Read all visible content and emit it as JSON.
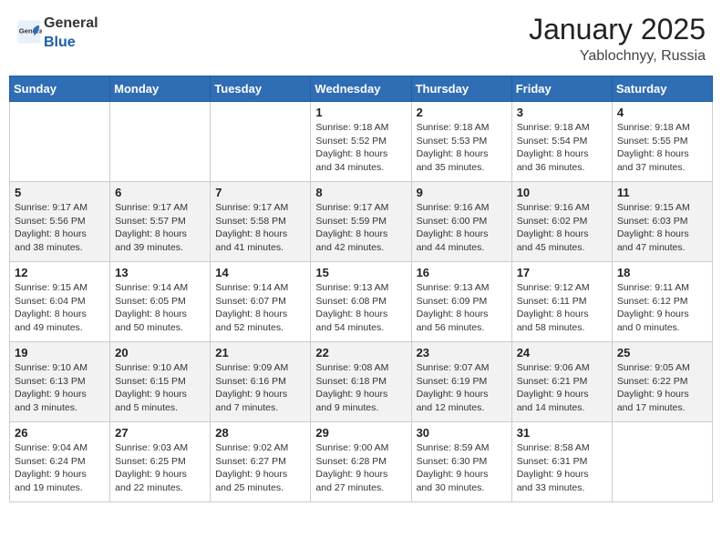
{
  "header": {
    "logo_general": "General",
    "logo_blue": "Blue",
    "month": "January 2025",
    "location": "Yablochnyy, Russia"
  },
  "days_of_week": [
    "Sunday",
    "Monday",
    "Tuesday",
    "Wednesday",
    "Thursday",
    "Friday",
    "Saturday"
  ],
  "weeks": [
    [
      {
        "day": "",
        "info": ""
      },
      {
        "day": "",
        "info": ""
      },
      {
        "day": "",
        "info": ""
      },
      {
        "day": "1",
        "info": "Sunrise: 9:18 AM\nSunset: 5:52 PM\nDaylight: 8 hours\nand 34 minutes."
      },
      {
        "day": "2",
        "info": "Sunrise: 9:18 AM\nSunset: 5:53 PM\nDaylight: 8 hours\nand 35 minutes."
      },
      {
        "day": "3",
        "info": "Sunrise: 9:18 AM\nSunset: 5:54 PM\nDaylight: 8 hours\nand 36 minutes."
      },
      {
        "day": "4",
        "info": "Sunrise: 9:18 AM\nSunset: 5:55 PM\nDaylight: 8 hours\nand 37 minutes."
      }
    ],
    [
      {
        "day": "5",
        "info": "Sunrise: 9:17 AM\nSunset: 5:56 PM\nDaylight: 8 hours\nand 38 minutes."
      },
      {
        "day": "6",
        "info": "Sunrise: 9:17 AM\nSunset: 5:57 PM\nDaylight: 8 hours\nand 39 minutes."
      },
      {
        "day": "7",
        "info": "Sunrise: 9:17 AM\nSunset: 5:58 PM\nDaylight: 8 hours\nand 41 minutes."
      },
      {
        "day": "8",
        "info": "Sunrise: 9:17 AM\nSunset: 5:59 PM\nDaylight: 8 hours\nand 42 minutes."
      },
      {
        "day": "9",
        "info": "Sunrise: 9:16 AM\nSunset: 6:00 PM\nDaylight: 8 hours\nand 44 minutes."
      },
      {
        "day": "10",
        "info": "Sunrise: 9:16 AM\nSunset: 6:02 PM\nDaylight: 8 hours\nand 45 minutes."
      },
      {
        "day": "11",
        "info": "Sunrise: 9:15 AM\nSunset: 6:03 PM\nDaylight: 8 hours\nand 47 minutes."
      }
    ],
    [
      {
        "day": "12",
        "info": "Sunrise: 9:15 AM\nSunset: 6:04 PM\nDaylight: 8 hours\nand 49 minutes."
      },
      {
        "day": "13",
        "info": "Sunrise: 9:14 AM\nSunset: 6:05 PM\nDaylight: 8 hours\nand 50 minutes."
      },
      {
        "day": "14",
        "info": "Sunrise: 9:14 AM\nSunset: 6:07 PM\nDaylight: 8 hours\nand 52 minutes."
      },
      {
        "day": "15",
        "info": "Sunrise: 9:13 AM\nSunset: 6:08 PM\nDaylight: 8 hours\nand 54 minutes."
      },
      {
        "day": "16",
        "info": "Sunrise: 9:13 AM\nSunset: 6:09 PM\nDaylight: 8 hours\nand 56 minutes."
      },
      {
        "day": "17",
        "info": "Sunrise: 9:12 AM\nSunset: 6:11 PM\nDaylight: 8 hours\nand 58 minutes."
      },
      {
        "day": "18",
        "info": "Sunrise: 9:11 AM\nSunset: 6:12 PM\nDaylight: 9 hours\nand 0 minutes."
      }
    ],
    [
      {
        "day": "19",
        "info": "Sunrise: 9:10 AM\nSunset: 6:13 PM\nDaylight: 9 hours\nand 3 minutes."
      },
      {
        "day": "20",
        "info": "Sunrise: 9:10 AM\nSunset: 6:15 PM\nDaylight: 9 hours\nand 5 minutes."
      },
      {
        "day": "21",
        "info": "Sunrise: 9:09 AM\nSunset: 6:16 PM\nDaylight: 9 hours\nand 7 minutes."
      },
      {
        "day": "22",
        "info": "Sunrise: 9:08 AM\nSunset: 6:18 PM\nDaylight: 9 hours\nand 9 minutes."
      },
      {
        "day": "23",
        "info": "Sunrise: 9:07 AM\nSunset: 6:19 PM\nDaylight: 9 hours\nand 12 minutes."
      },
      {
        "day": "24",
        "info": "Sunrise: 9:06 AM\nSunset: 6:21 PM\nDaylight: 9 hours\nand 14 minutes."
      },
      {
        "day": "25",
        "info": "Sunrise: 9:05 AM\nSunset: 6:22 PM\nDaylight: 9 hours\nand 17 minutes."
      }
    ],
    [
      {
        "day": "26",
        "info": "Sunrise: 9:04 AM\nSunset: 6:24 PM\nDaylight: 9 hours\nand 19 minutes."
      },
      {
        "day": "27",
        "info": "Sunrise: 9:03 AM\nSunset: 6:25 PM\nDaylight: 9 hours\nand 22 minutes."
      },
      {
        "day": "28",
        "info": "Sunrise: 9:02 AM\nSunset: 6:27 PM\nDaylight: 9 hours\nand 25 minutes."
      },
      {
        "day": "29",
        "info": "Sunrise: 9:00 AM\nSunset: 6:28 PM\nDaylight: 9 hours\nand 27 minutes."
      },
      {
        "day": "30",
        "info": "Sunrise: 8:59 AM\nSunset: 6:30 PM\nDaylight: 9 hours\nand 30 minutes."
      },
      {
        "day": "31",
        "info": "Sunrise: 8:58 AM\nSunset: 6:31 PM\nDaylight: 9 hours\nand 33 minutes."
      },
      {
        "day": "",
        "info": ""
      }
    ]
  ]
}
